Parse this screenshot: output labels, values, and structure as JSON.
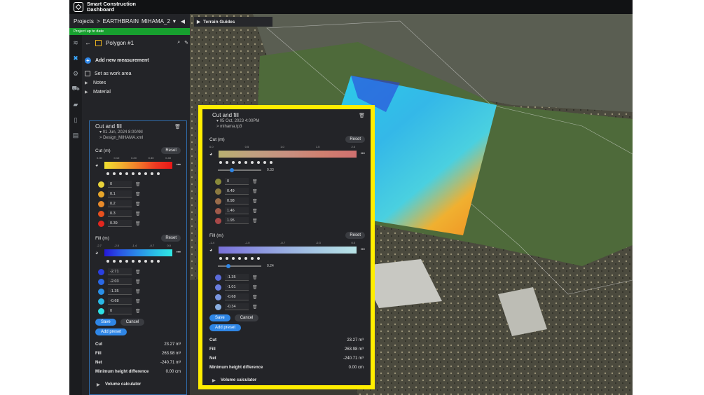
{
  "brand": {
    "name_line1": "Smart Construction",
    "name_line2": "Dashboard"
  },
  "breadcrumb": {
    "projects": "Projects",
    "sep": ">",
    "org": "EARTHBRAIN",
    "site": "MIHAMA_2"
  },
  "status": "Project up to date",
  "panel": {
    "title": "Polygon #1",
    "add_measurement": "Add new measurement",
    "set_work_area": "Set as work area",
    "notes": "Notes",
    "material": "Material"
  },
  "cutfill_left": {
    "title": "Cut and fill",
    "date": "01 Jun, 2024 8:00AM",
    "design": "> Design_MIHAMA.xml",
    "cut_label": "Cut (m)",
    "cut_ticks": [
      "0.00",
      "0.10",
      "0.20",
      "0.30",
      "0.40"
    ],
    "cut_values": [
      "0",
      "0.1",
      "0.2",
      "0.3",
      "0.39"
    ],
    "fill_label": "Fill (m)",
    "fill_ticks": [
      "-2.7",
      "-2.0",
      "-1.4",
      "-0.7",
      "0.0"
    ],
    "fill_values": [
      "-2.71",
      "-2.03",
      "-1.35",
      "-0.68",
      "0"
    ],
    "reset": "Reset",
    "save": "Save",
    "cancel": "Cancel",
    "add_preset": "Add preset",
    "stats": [
      {
        "label": "Cut",
        "value": "23.27 m³"
      },
      {
        "label": "Fill",
        "value": "263.98 m³"
      },
      {
        "label": "Net",
        "value": "-240.71 m³"
      },
      {
        "label": "Minimum height difference",
        "value": "0.00 cm"
      }
    ],
    "volume_calc": "Volume calculator"
  },
  "cutfill_right": {
    "title": "Cut and fill",
    "date": "05 Oct, 2023 4:00PM",
    "design": "> mihama.tp3",
    "cut_label": "Cut (m)",
    "cut_ticks": [
      "0.0",
      "0.5",
      "1.0",
      "1.5",
      "2.0"
    ],
    "cut_slider": "0.33",
    "cut_slider_fraction": 0.33,
    "cut_values": [
      "0",
      "0.49",
      "0.98",
      "1.46",
      "1.95"
    ],
    "fill_label": "Fill (m)",
    "fill_ticks": [
      "-1.4",
      "-1.0",
      "-0.7",
      "-0.3",
      "0.0"
    ],
    "fill_slider": "0.24",
    "fill_slider_fraction": 0.24,
    "fill_values": [
      "-1.35",
      "-1.01",
      "-0.68",
      "-0.34"
    ],
    "reset": "Reset",
    "save": "Save",
    "cancel": "Cancel",
    "add_preset": "Add preset",
    "stats": [
      {
        "label": "Cut",
        "value": "23.27 m³"
      },
      {
        "label": "Fill",
        "value": "263.98 m³"
      },
      {
        "label": "Net",
        "value": "-240.71 m³"
      },
      {
        "label": "Minimum height difference",
        "value": "0.00 cm"
      }
    ],
    "volume_calc": "Volume calculator"
  },
  "map": {
    "terrain_guides": "Terrain Guides"
  },
  "colors": {
    "accent": "#2f86e6",
    "status_green": "#17a02f",
    "highlight": "#ffee00",
    "cut_swatches": [
      "#e8d23a",
      "#e6a52a",
      "#e88a2a",
      "#e8501e",
      "#e2261e"
    ],
    "fill_swatches": [
      "#2a3fe0",
      "#2a68e6",
      "#2a90e8",
      "#2ab8e6",
      "#2ee0e4"
    ],
    "cut_swatches_right": [
      "#8a8a3a",
      "#8c7a40",
      "#9a6c4a",
      "#a05a4a",
      "#a84848"
    ],
    "fill_swatches_right": [
      "#5a6ad8",
      "#6a7ede",
      "#7a96e0",
      "#8aaee0"
    ]
  }
}
